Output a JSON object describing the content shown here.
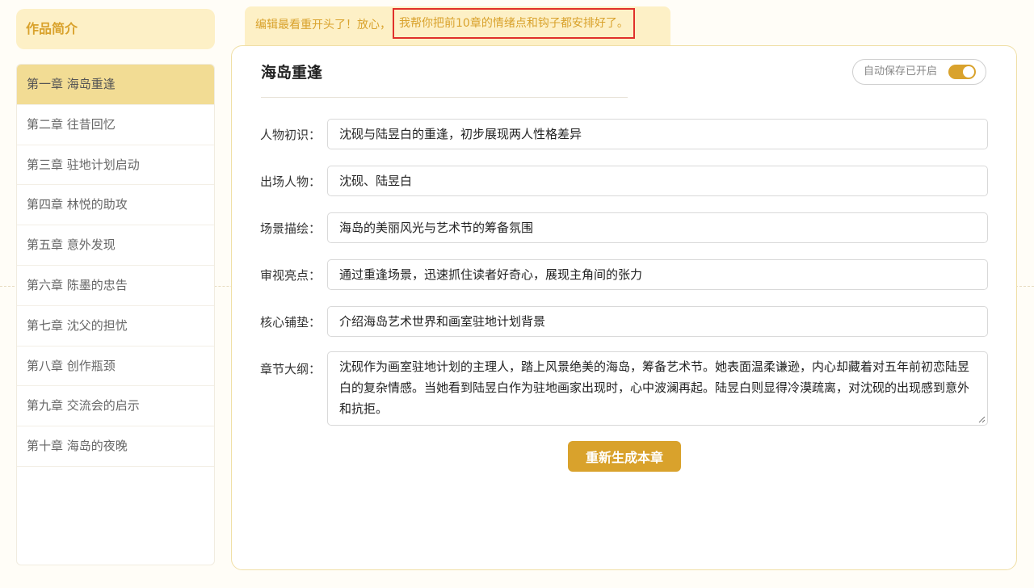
{
  "sidebar": {
    "title": "作品简介",
    "chapters": [
      {
        "label": "第一章 海岛重逢",
        "active": true
      },
      {
        "label": "第二章 往昔回忆"
      },
      {
        "label": "第三章 驻地计划启动"
      },
      {
        "label": "第四章 林悦的助攻"
      },
      {
        "label": "第五章 意外发现"
      },
      {
        "label": "第六章 陈墨的忠告"
      },
      {
        "label": "第七章 沈父的担忧"
      },
      {
        "label": "第八章 创作瓶颈"
      },
      {
        "label": "第九章 交流会的启示"
      },
      {
        "label": "第十章 海岛的夜晚"
      }
    ]
  },
  "banner": {
    "prefix": "编辑最看重开头了！放心，",
    "highlight": "我帮你把前10章的情绪点和钩子都安排好了。"
  },
  "panel": {
    "title": "海岛重逢",
    "autosave_label": "自动保存已开启",
    "autosave_on": true,
    "fields": [
      {
        "label": "人物初识：",
        "value": "沈砚与陆昱白的重逢，初步展现两人性格差异"
      },
      {
        "label": "出场人物：",
        "value": "沈砚、陆昱白"
      },
      {
        "label": "场景描绘：",
        "value": "海岛的美丽风光与艺术节的筹备氛围"
      },
      {
        "label": "审视亮点：",
        "value": "通过重逢场景，迅速抓住读者好奇心，展现主角间的张力"
      },
      {
        "label": "核心铺垫：",
        "value": "介绍海岛艺术世界和画室驻地计划背景"
      }
    ],
    "outline": {
      "label": "章节大纲：",
      "value": "沈砚作为画室驻地计划的主理人，踏上风景绝美的海岛，筹备艺术节。她表面温柔谦逊，内心却藏着对五年前初恋陆昱白的复杂情感。当她看到陆昱白作为驻地画家出现时，心中波澜再起。陆昱白则显得冷漠疏离，对沈砚的出现感到意外和抗拒。"
    },
    "regenerate_label": "重新生成本章"
  },
  "colors": {
    "accent": "#d9a22c",
    "banner_bg": "#fdf0c6",
    "active_item_bg": "#f2dc94",
    "highlight_border": "#e0302a"
  }
}
